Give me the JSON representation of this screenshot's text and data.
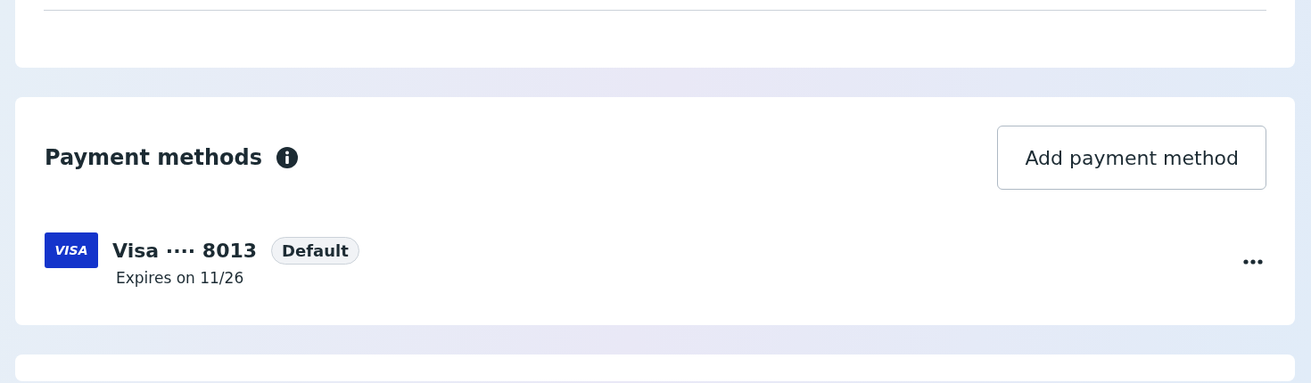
{
  "section": {
    "title": "Payment methods",
    "add_button": "Add payment method"
  },
  "payment_methods": [
    {
      "brand_label": "VISA",
      "name": "Visa ···· 8013",
      "is_default": true,
      "default_label": "Default",
      "expiry": "Expires on 11/26"
    }
  ]
}
